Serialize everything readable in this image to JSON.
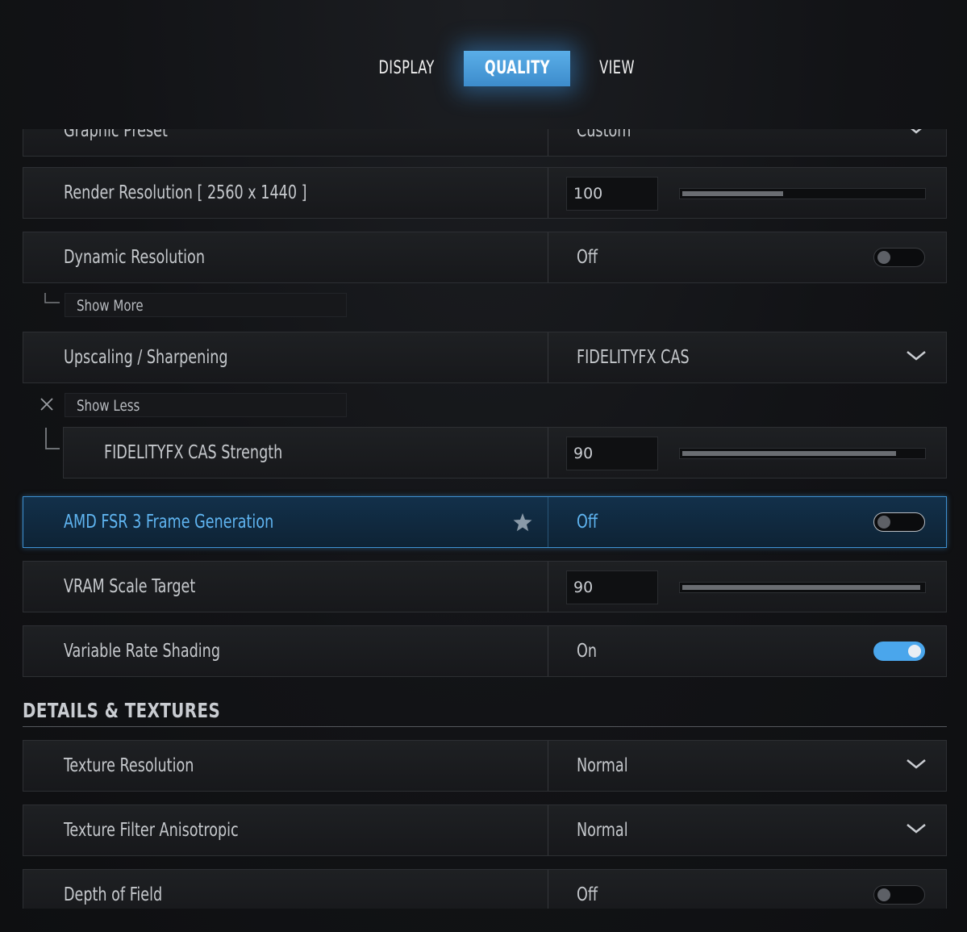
{
  "tabs": [
    {
      "label": "DISPLAY",
      "active": false
    },
    {
      "label": "QUALITY",
      "active": true
    },
    {
      "label": "VIEW",
      "active": false
    }
  ],
  "accent_color": "#3d8fd0",
  "rows": {
    "graphic_preset": {
      "label": "Graphic Preset",
      "value": "Custom",
      "control": "dropdown"
    },
    "render_resolution": {
      "label": "Render Resolution [ 2560 x 1440 ]",
      "value": "100",
      "control": "slider",
      "level": 0.42
    },
    "dynamic_resolution": {
      "label": "Dynamic Resolution",
      "value": "Off",
      "control": "toggle",
      "on": false
    },
    "upscaling": {
      "label": "Upscaling / Sharpening",
      "value": "FIDELITYFX CAS",
      "control": "dropdown"
    },
    "cas_strength": {
      "label": "FIDELITYFX CAS Strength",
      "value": "90",
      "control": "slider",
      "level": 0.89
    },
    "fsr3": {
      "label": "AMD FSR 3 Frame Generation",
      "value": "Off",
      "control": "toggle",
      "on": false,
      "favorite_icon": "star-icon"
    },
    "vram_scale": {
      "label": "VRAM Scale Target",
      "value": "90",
      "control": "slider",
      "level": 0.99
    },
    "vrs": {
      "label": "Variable Rate Shading",
      "value": "On",
      "control": "toggle",
      "on": true
    },
    "texture_resolution": {
      "label": "Texture Resolution",
      "value": "Normal",
      "control": "dropdown"
    },
    "texture_filter": {
      "label": "Texture Filter Anisotropic",
      "value": "Normal",
      "control": "dropdown"
    },
    "depth_of_field": {
      "label": "Depth of Field",
      "value": "Off",
      "control": "toggle",
      "on": false
    }
  },
  "show_more": {
    "label": "Show More"
  },
  "show_less": {
    "label": "Show Less"
  },
  "sections": {
    "details_textures": "DETAILS & TEXTURES"
  }
}
